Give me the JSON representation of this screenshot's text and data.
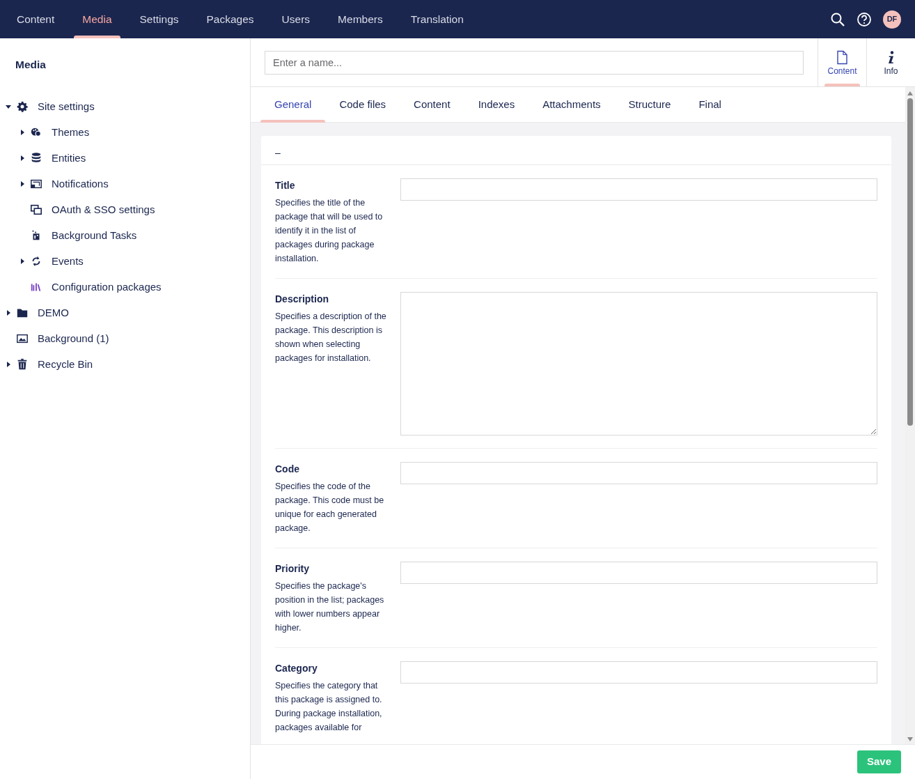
{
  "top_nav": {
    "sections": [
      {
        "label": "Content",
        "selected": false
      },
      {
        "label": "Media",
        "selected": true
      },
      {
        "label": "Settings",
        "selected": false
      },
      {
        "label": "Packages",
        "selected": false
      },
      {
        "label": "Users",
        "selected": false
      },
      {
        "label": "Members",
        "selected": false
      },
      {
        "label": "Translation",
        "selected": false
      }
    ],
    "avatar": "DF"
  },
  "sidebar": {
    "title": "Media",
    "tree": [
      {
        "label": "Site settings",
        "expanded": true,
        "children": [
          {
            "label": "Themes",
            "expanded": false
          },
          {
            "label": "Entities",
            "expanded": false
          },
          {
            "label": "Notifications",
            "expanded": false
          },
          {
            "label": "OAuth & SSO settings"
          },
          {
            "label": "Background Tasks"
          },
          {
            "label": "Events",
            "expanded": false
          },
          {
            "label": "Configuration packages"
          }
        ]
      },
      {
        "label": "DEMO",
        "expanded": false
      },
      {
        "label": "Background (1)"
      },
      {
        "label": "Recycle Bin",
        "expanded": false
      }
    ]
  },
  "editor": {
    "name_field": {
      "placeholder": "Enter a name..."
    },
    "apps": [
      {
        "label": "Content",
        "selected": true
      },
      {
        "label": "Info",
        "selected": false
      }
    ],
    "tabs": [
      {
        "label": "General",
        "selected": true
      },
      {
        "label": "Code files",
        "selected": false
      },
      {
        "label": "Content",
        "selected": false
      },
      {
        "label": "Indexes",
        "selected": false
      },
      {
        "label": "Attachments",
        "selected": false
      },
      {
        "label": "Structure",
        "selected": false
      },
      {
        "label": "Final",
        "selected": false
      }
    ],
    "group_header": "–",
    "fields": [
      {
        "kind": "input",
        "label": "Title",
        "description": "Specifies the title of the package that will be used to identify it in the list of packages during package installation."
      },
      {
        "kind": "textarea",
        "label": "Description",
        "description": "Specifies a description of the package. This description is shown when selecting packages for installation."
      },
      {
        "kind": "input",
        "label": "Code",
        "description": "Specifies the code of the package. This code must be unique for each generated package."
      },
      {
        "kind": "input",
        "label": "Priority",
        "description": "Specifies the package's position in the list; packages with lower numbers appear higher."
      },
      {
        "kind": "input",
        "label": "Category",
        "description": "Specifies the category that this package is assigned to. During package installation, packages available for"
      }
    ],
    "save_button": "Save"
  }
}
